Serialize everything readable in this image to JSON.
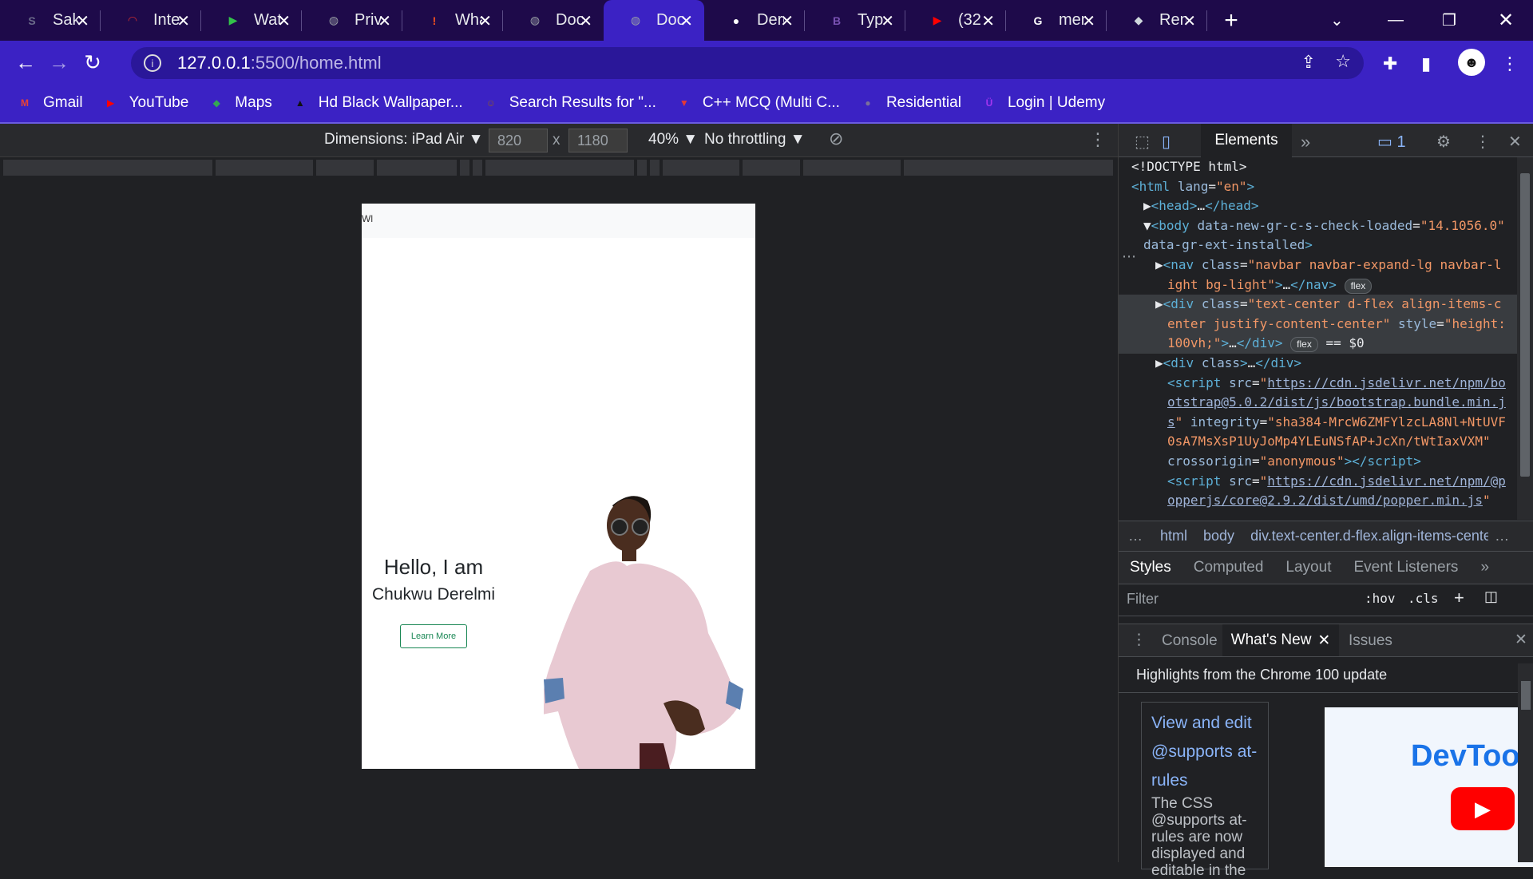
{
  "tabs": [
    {
      "title": "Sakura",
      "icon": "site-icon",
      "color": "#6b6b8a",
      "glyph": "S"
    },
    {
      "title": "Internet",
      "icon": "speedometer-icon",
      "color": "#d32f2f",
      "glyph": "◠"
    },
    {
      "title": "Watch",
      "icon": "play-icon",
      "color": "#33c24a",
      "glyph": "▶"
    },
    {
      "title": "Privacy",
      "icon": "globe-icon",
      "color": "#9aa0a6",
      "glyph": "◍"
    },
    {
      "title": "What",
      "icon": "alert-icon",
      "color": "#f4511e",
      "glyph": "!"
    },
    {
      "title": "Document",
      "icon": "globe-icon",
      "color": "#9aa0a6",
      "glyph": "◍"
    },
    {
      "title": "Document",
      "icon": "globe-icon",
      "color": "#9aa0a6",
      "glyph": "◍"
    },
    {
      "title": "Derelmi",
      "icon": "github-icon",
      "color": "#ffffff",
      "glyph": "●"
    },
    {
      "title": "Typ",
      "icon": "bootstrap-icon",
      "color": "#7952b3",
      "glyph": "B"
    },
    {
      "title": "(32",
      "icon": "youtube-icon",
      "color": "#ff0000",
      "glyph": "▶"
    },
    {
      "title": "men",
      "icon": "google-icon",
      "color": "#ffffff",
      "glyph": "G"
    },
    {
      "title": "Ren",
      "icon": "render-icon",
      "color": "#cfd8dc",
      "glyph": "◆"
    }
  ],
  "active_tab_index": 6,
  "address": {
    "host": "127.0.0.1",
    "rest": ":5500/home.html"
  },
  "bookmarks": [
    {
      "label": "Gmail",
      "icon": "gmail-icon",
      "color": "#ea4335",
      "glyph": "M"
    },
    {
      "label": "YouTube",
      "icon": "youtube-icon",
      "color": "#ff0000",
      "glyph": "▶"
    },
    {
      "label": "Maps",
      "icon": "maps-icon",
      "color": "#34a853",
      "glyph": "◆"
    },
    {
      "label": "Hd Black Wallpaper...",
      "icon": "wallpaper-icon",
      "color": "#111111",
      "glyph": "▲"
    },
    {
      "label": "Search Results for \"...",
      "icon": "search-result-icon",
      "color": "#8d5a2b",
      "glyph": "☺"
    },
    {
      "label": "C++ MCQ (Multi C...",
      "icon": "mcq-icon",
      "color": "#e53935",
      "glyph": "▼"
    },
    {
      "label": "Residential",
      "icon": "residential-icon",
      "color": "#7a6f9b",
      "glyph": "●"
    },
    {
      "label": "Login | Udemy",
      "icon": "udemy-icon",
      "color": "#a435f0",
      "glyph": "Ü"
    }
  ],
  "device_toolbar": {
    "dimensions_label": "Dimensions: iPad Air ▼",
    "width": "820",
    "times": "x",
    "height": "1180",
    "zoom": "40% ▼",
    "throttling": "No throttling ▼"
  },
  "page": {
    "brand": "Wl",
    "hello": "Hello, I am",
    "name": "Chukwu Derelmi",
    "button": "Learn More"
  },
  "devtools": {
    "active_tab": "Elements",
    "issues_count": "1",
    "dom": [
      {
        "html": "<span class='txt'>&lt;!DOCTYPE html&gt;</span>",
        "indent": 0
      },
      {
        "html": "<span class='tag'>&lt;html</span> <span class='attr'>lang</span>=<span class='val'>\"en\"</span><span class='tag'>&gt;</span>",
        "indent": 0
      },
      {
        "html": "<span class='txt'>▶</span><span class='tag'>&lt;head&gt;</span>…<span class='tag'>&lt;/head&gt;</span>",
        "indent": 1
      },
      {
        "html": "<span class='txt'>▼</span><span class='tag'>&lt;body</span> <span class='attr'>data-new-gr-c-s-check-loaded</span>=<span class='val'>\"14.1056.0\"</span>",
        "indent": 1
      },
      {
        "html": "<span class='attr'>data-gr-ext-installed</span><span class='tag'>&gt;</span>",
        "indent": 1
      },
      {
        "html": "<span class='txt'>▶</span><span class='tag'>&lt;nav</span> <span class='attr'>class</span>=<span class='val'>\"navbar navbar-expand-lg navbar-l</span>",
        "indent": 2
      },
      {
        "html": "<span class='val'>ight bg-light\"</span><span class='tag'>&gt;</span>…<span class='tag'>&lt;/nav&gt;</span> <span class='badge'>flex</span>",
        "indent": 3
      },
      {
        "html": "<span class='txt'>▶</span><span class='tag'>&lt;div</span> <span class='attr'>class</span>=<span class='val'>\"text-center d-flex align-items-c</span>",
        "indent": 2,
        "selected": true
      },
      {
        "html": "<span class='val'>enter justify-content-center\"</span> <span class='attr'>style</span>=<span class='val'>\"height:</span>",
        "indent": 3,
        "selected": true
      },
      {
        "html": "<span class='val'>100vh;\"</span><span class='tag'>&gt;</span>…<span class='tag'>&lt;/div&gt;</span> <span class='badge'>flex</span> <span class='txt'>== $0</span>",
        "indent": 3,
        "selected": true
      },
      {
        "html": "<span class='txt'>▶</span><span class='tag'>&lt;div</span> <span class='attr'>class</span><span class='tag'>&gt;</span>…<span class='tag'>&lt;/div&gt;</span>",
        "indent": 2
      },
      {
        "html": "<span class='tag'>&lt;script</span> <span class='attr'>src</span>=<span class='val'>\"</span><span class='link'>https://cdn.jsdelivr.net/npm/bo</span>",
        "indent": 3
      },
      {
        "html": "<span class='link'>otstrap@5.0.2/dist/js/bootstrap.bundle.min.j</span>",
        "indent": 3
      },
      {
        "html": "<span class='link'>s</span><span class='val'>\"</span> <span class='attr'>integrity</span>=<span class='val'>\"sha384-MrcW6ZMFYlzcLA8Nl+NtUVF</span>",
        "indent": 3
      },
      {
        "html": "<span class='val'>0sA7MsXsP1UyJoMp4YLEuNSfAP+JcXn/tWtIaxVXM\"</span>",
        "indent": 3
      },
      {
        "html": "<span class='attr'>crossorigin</span>=<span class='val'>\"anonymous\"</span><span class='tag'>&gt;&lt;/script&gt;</span>",
        "indent": 3
      },
      {
        "html": "<span class='tag'>&lt;script</span> <span class='attr'>src</span>=<span class='val'>\"</span><span class='link'>https://cdn.jsdelivr.net/npm/@p</span>",
        "indent": 3
      },
      {
        "html": "<span class='link'>opperjs/core@2.9.2/dist/umd/popper.min.js</span><span class='val'>\"</span>",
        "indent": 3
      }
    ],
    "breadcrumbs": [
      "html",
      "body",
      "div.text-center.d-flex.align-items-cente"
    ],
    "styles_tabs": [
      "Styles",
      "Computed",
      "Layout",
      "Event Listeners"
    ],
    "filter_placeholder": "Filter",
    "hov": ":hov",
    "cls": ".cls",
    "drawer_tabs": [
      "Console",
      "What's New",
      "Issues"
    ],
    "drawer_heading": "Highlights from the Chrome 100 update",
    "card_title": "View and edit @supports at-rules",
    "card_body": "The CSS @supports at-rules are now displayed and editable in the",
    "promo_text": "DevToo"
  }
}
